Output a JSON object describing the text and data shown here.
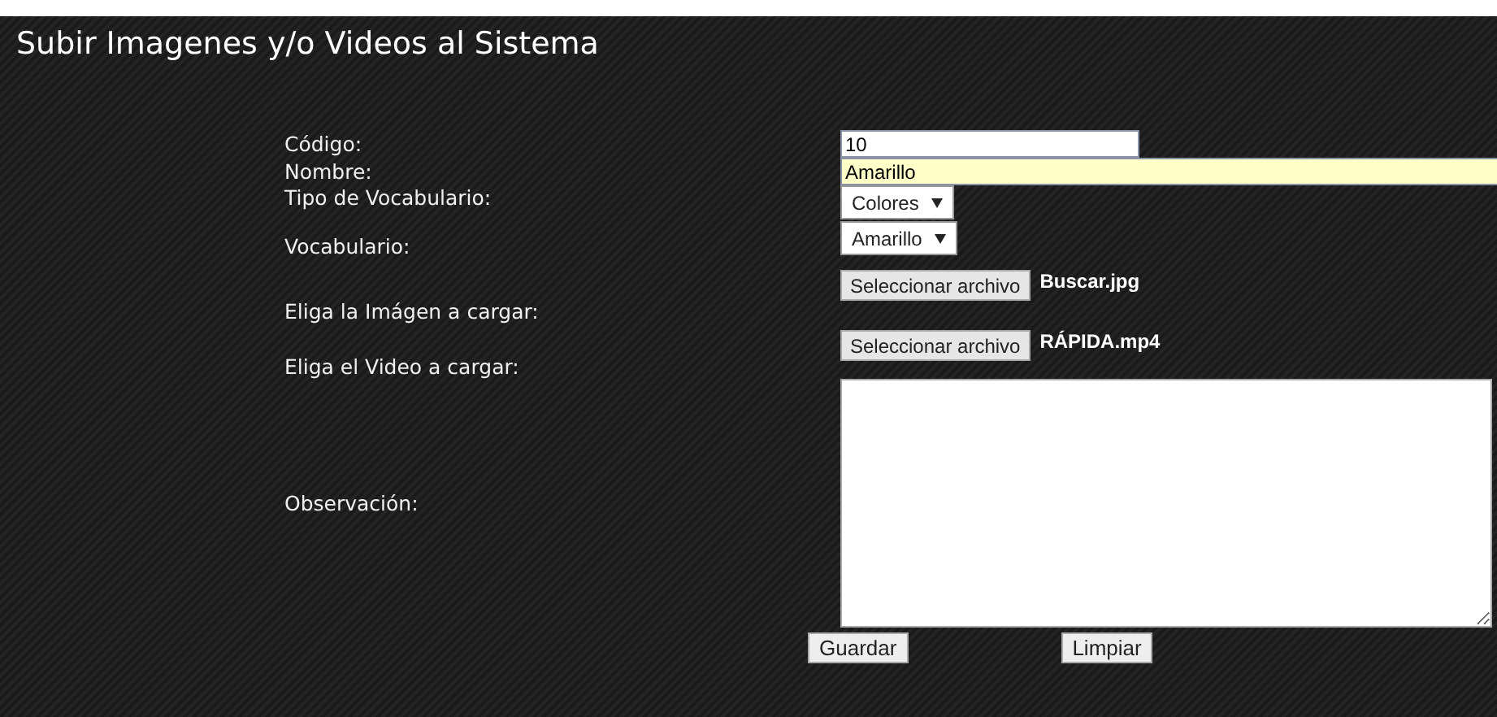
{
  "title": "Subir Imagenes y/o Videos al Sistema",
  "fields": [
    {
      "kind": "text",
      "label": "Código:",
      "value": "10",
      "focused": false
    },
    {
      "kind": "text",
      "label": "Nombre:",
      "value": "Amarillo",
      "focused": true
    },
    {
      "kind": "select",
      "label": "Tipo de Vocabulario:",
      "value": "Colores"
    },
    {
      "kind": "select",
      "label": "Vocabulario:",
      "value": "Amarillo"
    },
    {
      "kind": "file",
      "label": "Eliga la Imágen a cargar:",
      "button": "Seleccionar archivo",
      "file": "Buscar.jpg"
    },
    {
      "kind": "file",
      "label": "Eliga el Video a cargar:",
      "button": "Seleccionar archivo",
      "file": "RÁPIDA.mp4"
    },
    {
      "kind": "textarea",
      "label": "Observación:"
    }
  ],
  "buttons": [
    "Guardar",
    "Limpiar"
  ]
}
